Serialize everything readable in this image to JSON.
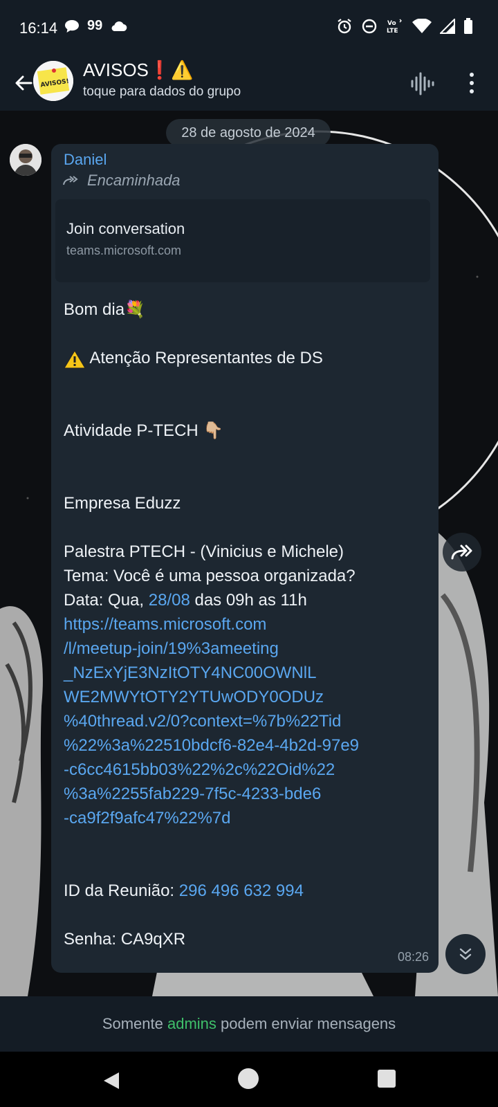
{
  "status_bar": {
    "time": "16:14",
    "left_icons": [
      "chat-bubble-icon",
      "quote-icon",
      "cloud-icon"
    ],
    "quote_glyph": "99",
    "right_icons": [
      "alarm-icon",
      "dnd-icon",
      "volte-icon",
      "wifi-icon",
      "signal-icon",
      "battery-icon"
    ],
    "volte_label": "Vo LTE"
  },
  "header": {
    "title": "AVISOS❗⚠️",
    "subtitle": "toque para dados do grupo",
    "avatar_text": "AVISOS!"
  },
  "chat": {
    "date_separator": "28 de agosto de 2024",
    "message": {
      "sender": "Daniel",
      "forwarded_label": "Encaminhada",
      "link_preview": {
        "title": "Join conversation",
        "domain": "teams.microsoft.com"
      },
      "lines": {
        "l1": "Bom dia💐",
        "l3_text": " Atenção Representantes de DS",
        "l6": "Atividade P-TECH 👇🏼",
        "l9": "Empresa Eduzz",
        "l11": "Palestra PTECH - (Vinicius e Michele)",
        "l12": "Tema: Você é uma pessoa organizada?",
        "l13_a": "Data: Qua, ",
        "l13_link": "28/08",
        "l13_b": " das 09h as 11h",
        "url_lines": [
          "https://teams.microsoft.com",
          "/l/meetup-join/19%3ameeting",
          "_NzExYjE3NzItOTY4NC00OWNlL",
          "WE2MWYtOTY2YTUwODY0ODUz",
          "%40thread.v2/0?context=%7b%22Tid",
          "%22%3a%22510bdcf6-82e4-4b2d-97e9",
          "-c6cc4615bb03%22%2c%22Oid%22",
          "%3a%2255fab229-7f5c-4233-bde6",
          "-ca9f2f9afc47%22%7d"
        ],
        "meeting_id_label": "ID da Reunião: ",
        "meeting_id": "296 496 632 994",
        "password": "Senha: CA9qXR"
      },
      "time": "08:26"
    }
  },
  "footer": {
    "prefix": "Somente ",
    "highlight": "admins",
    "suffix": " podem enviar mensagens"
  },
  "colors": {
    "accent_link": "#5aa7f0",
    "admins_green": "#3fc06a",
    "bubble_bg": "#1d2731",
    "bar_bg": "#141c25"
  }
}
